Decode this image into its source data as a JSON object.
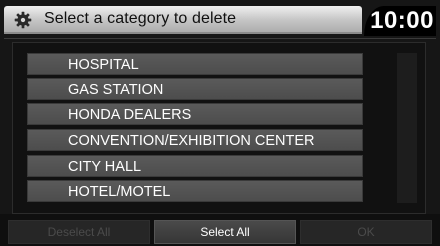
{
  "header": {
    "title": "Select a category to delete",
    "clock": "10:00"
  },
  "categories": [
    {
      "label": "HOSPITAL"
    },
    {
      "label": "GAS STATION"
    },
    {
      "label": "HONDA DEALERS"
    },
    {
      "label": "CONVENTION/EXHIBITION CENTER"
    },
    {
      "label": "CITY HALL"
    },
    {
      "label": "HOTEL/MOTEL"
    }
  ],
  "buttons": {
    "deselect_all": "Deselect All",
    "select_all": "Select All",
    "ok": "OK"
  },
  "icons": {
    "header": "gear-icon"
  }
}
